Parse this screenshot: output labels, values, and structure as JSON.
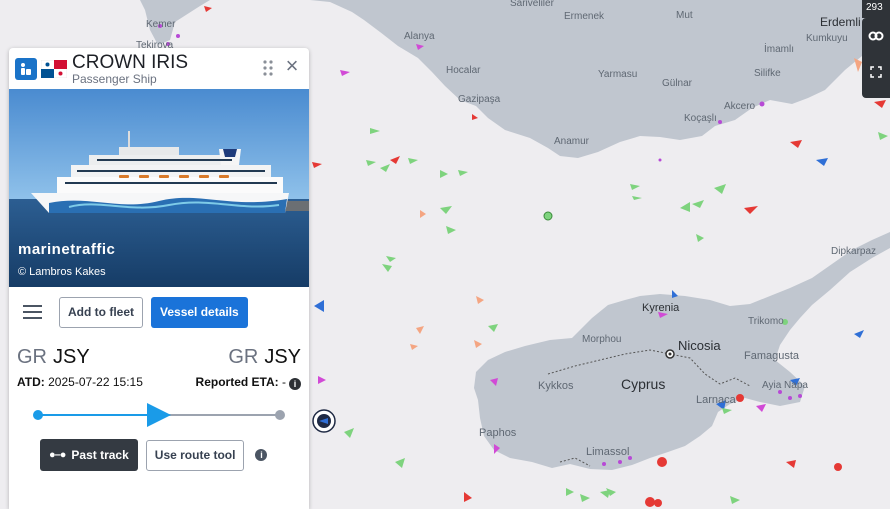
{
  "map": {
    "places": {
      "kemer": "Kemer",
      "tekirova": "Tekirova",
      "sariveliler": "Sariveliler",
      "ermenek": "Ermenek",
      "mut": "Mut",
      "erdemli": "Erdemli",
      "kumkuyu": "Kumkuyu",
      "alanya": "Alanya",
      "imamli": "İmamlı",
      "hocalar": "Hocalar",
      "yarmasu": "Yarmasu",
      "silifke": "Silifke",
      "gulnar": "Gülnar",
      "gazipasa": "Gazipaşa",
      "akcero": "Akcero",
      "kocasli": "Koçaşlı",
      "anamur": "Anamur",
      "dipkarpaz": "Dipkarpaz",
      "kyrenia": "Kyrenia",
      "trikomo": "Trikomo",
      "morphou": "Morphou",
      "nicosia": "Nicosia",
      "famagusta": "Famagusta",
      "ayia_napa": "Ayia Napa",
      "kykkos": "Kykkos",
      "cyprus": "Cyprus",
      "larnaca": "Larnaca",
      "paphos": "Paphos",
      "limassol": "Limassol"
    },
    "zoom_readout": "293",
    "controls": {
      "layers_icon": "layers-icon",
      "fullscreen_icon": "fullscreen-icon"
    },
    "colors": {
      "sea": "#eeedf0",
      "land": "#c0c6cf",
      "passenger": "#2f6fd6",
      "cargo": "#7ed37e",
      "tanker": "#e53935",
      "other": "#d14ad6"
    }
  },
  "panel": {
    "vessel_name": "CROWN IRIS",
    "vessel_type": "Passenger Ship",
    "type_icon": "passenger-icon",
    "flag": "panama-flag",
    "photo": {
      "watermark": "marinetraffic",
      "credit": "© Lambros Kakes"
    },
    "buttons": {
      "add_to_fleet": "Add to fleet",
      "vessel_details": "Vessel details",
      "past_track": "Past track",
      "use_route_tool": "Use route tool"
    },
    "departure": {
      "country": "GR",
      "port": "JSY"
    },
    "arrival": {
      "country": "GR",
      "port": "JSY"
    },
    "atd_label": "ATD:",
    "atd_value": "2025-07-22 15:15",
    "eta_label": "Reported ETA:",
    "eta_value": "-",
    "progress": 0.5,
    "colors": {
      "accent": "#1a73d9",
      "progress": "#1a9be8"
    }
  }
}
